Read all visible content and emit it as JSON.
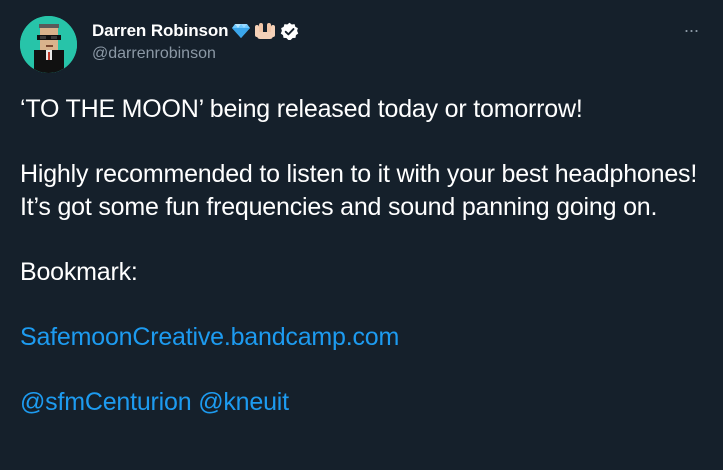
{
  "author": {
    "display_name": "Darren Robinson",
    "handle": "@darrenrobinson",
    "badges": [
      "gem-icon",
      "raising-hands-icon",
      "verified-badge-icon"
    ]
  },
  "menu": {
    "more_label": "···"
  },
  "tweet": {
    "line1": "‘TO THE MOON’ being released today or tomorrow!",
    "line2": "Highly recommended to listen to it with your best headphones! It’s got some fun frequencies and sound panning going on.",
    "line3": "Bookmark:",
    "link_url_text": "SafemoonCreative.bandcamp.com",
    "mention1": "@sfmCenturion",
    "mention2": "@kneuit"
  },
  "colors": {
    "background": "#15202b",
    "text": "#ffffff",
    "secondary_text": "#8b98a5",
    "link": "#1d9bf0",
    "avatar_bg": "#27c4a9"
  }
}
